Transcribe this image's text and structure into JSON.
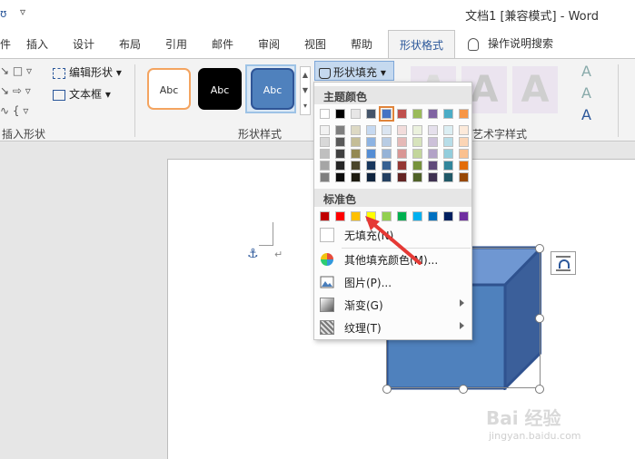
{
  "titlebar": {
    "quick_access": "ʊ",
    "quick_access2": "▿",
    "title": "文档1 [兼容模式] - Word"
  },
  "tabs": [
    {
      "label": "件",
      "left": 0
    },
    {
      "label": "插入"
    },
    {
      "label": "设计"
    },
    {
      "label": "布局"
    },
    {
      "label": "引用"
    },
    {
      "label": "邮件"
    },
    {
      "label": "审阅"
    },
    {
      "label": "视图"
    },
    {
      "label": "帮助"
    }
  ],
  "active_tab": "形状格式",
  "search_tab": "操作说明搜索",
  "ribbon": {
    "insert_shape": {
      "label": "插入形状",
      "row1": "↘ □ ▿",
      "row2": "↘ ⇨ ▿",
      "row3": "∿ { ▿",
      "edit_shape": "编辑形状",
      "text_box": "文本框"
    },
    "shape_styles": {
      "label": "形状样式",
      "samples": [
        "Abc",
        "Abc",
        "Abc"
      ],
      "scroll": [
        "▲",
        "▼",
        "▾"
      ]
    },
    "shape_fill": "形状填充",
    "art_styles": {
      "label": "艺术字样式",
      "letters": [
        "A",
        "A",
        "A"
      ],
      "side_icons": [
        "A",
        "A",
        "A"
      ]
    }
  },
  "fill_menu": {
    "theme_colors_header": "主题颜色",
    "theme_colors": [
      [
        "#ffffff",
        "#000000",
        "#e7e6e6",
        "#44546a",
        "#4472c4",
        "#c0504d",
        "#9bbb59",
        "#8064a2",
        "#4bacc6",
        "#f79646"
      ],
      [
        "#f2f2f2",
        "#7f7f7f",
        "#ddd9c4",
        "#c6d9f1",
        "#dbe5f1",
        "#f2dcdb",
        "#ebf1dd",
        "#e5e0ec",
        "#dbeef3",
        "#fdeada"
      ],
      [
        "#d8d8d8",
        "#595959",
        "#c4bd97",
        "#8db3e2",
        "#b8cce4",
        "#e5b9b7",
        "#d7e3bc",
        "#ccc1d9",
        "#b7dde8",
        "#fbd5b5"
      ],
      [
        "#bfbfbf",
        "#3f3f3f",
        "#938953",
        "#548dd4",
        "#95b3d7",
        "#d99694",
        "#c3d69b",
        "#b2a2c7",
        "#92cddc",
        "#fac08f"
      ],
      [
        "#a5a5a5",
        "#262626",
        "#494429",
        "#17365d",
        "#366092",
        "#953734",
        "#76923c",
        "#5f497a",
        "#31859b",
        "#e36c09"
      ],
      [
        "#7f7f7f",
        "#0c0c0c",
        "#1d1b10",
        "#0f243e",
        "#244061",
        "#632423",
        "#4f6128",
        "#3f3151",
        "#205867",
        "#974806"
      ]
    ],
    "selected_theme": "#4472c4",
    "standard_colors_header": "标准色",
    "standard_colors": [
      "#c00000",
      "#ff0000",
      "#ffc000",
      "#ffff00",
      "#92d050",
      "#00b050",
      "#00b0f0",
      "#0070c0",
      "#002060",
      "#7030a0"
    ],
    "no_fill": "无填充(N)",
    "more_colors": "其他填充颜色(M)...",
    "picture": "图片(P)...",
    "gradient": "渐变(G)",
    "texture": "纹理(T)"
  },
  "document": {
    "para_mark": "↵",
    "anchor": "⚓"
  },
  "watermark": {
    "main": "Bai 经验",
    "sub": "jingyan.baidu.com"
  }
}
